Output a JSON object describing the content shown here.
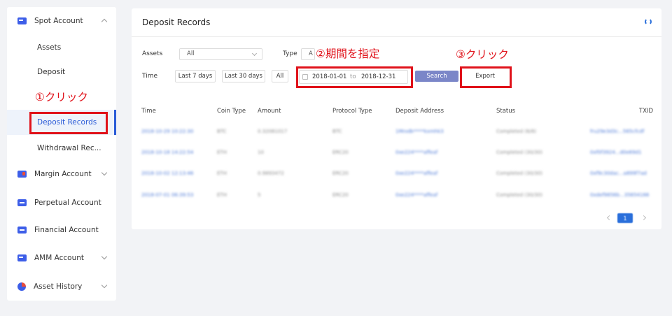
{
  "sidebar": {
    "spot_account": "Spot Account",
    "assets": "Assets",
    "deposit": "Deposit",
    "deposit_records": "Deposit Records",
    "withdrawal_records": "Withdrawal Rec...",
    "margin_account": "Margin Account",
    "perpetual_account": "Perpetual Account",
    "financial_account": "Financial Account",
    "amm_account": "AMM Account",
    "asset_history": "Asset History"
  },
  "panel": {
    "title": "Deposit Records"
  },
  "filters": {
    "assets_label": "Assets",
    "assets_value": "All",
    "type_label": "Type",
    "type_value": "A",
    "time_label": "Time",
    "last7": "Last 7 days",
    "last30": "Last 30 days",
    "all": "All",
    "date_from": "2018-01-01",
    "date_to_label": "to",
    "date_to": "2018-12-31",
    "search": "Search",
    "export": "Export"
  },
  "annotations": {
    "step1": "①クリック",
    "step2": "②期間を指定",
    "step3": "③クリック"
  },
  "table": {
    "headers": [
      "Time",
      "Coin Type",
      "Amount",
      "Protocol Type",
      "Deposit Address",
      "Status",
      "TXID"
    ],
    "rows": [
      [
        "2018-10-29 10:22:30",
        "BTC",
        "0.32081017",
        "BTC",
        "1MnxBr****kxmhk3",
        "Completed (6/6)",
        "fru29e3d3c...565cfcdf"
      ],
      [
        "2018-10-18 14:22:54",
        "ETH",
        "10",
        "ERC20",
        "0xe224****affeaf",
        "Completed (30/30)",
        "0xf0f3924...d0e69d1"
      ],
      [
        "2018-10-02 12:13:46",
        "ETH",
        "0.9893472",
        "ERC20",
        "0xe224****affeaf",
        "Completed (30/30)",
        "0xf9c30dac...a899f7ad"
      ],
      [
        "2018-07-01 06:39:53",
        "ETH",
        "5",
        "ERC20",
        "0xe224****affeaf",
        "Completed (30/30)",
        "0xdef9856b...35654166"
      ]
    ]
  },
  "pagination": {
    "current": "1"
  },
  "colors": {
    "accent": "#2a5bd7",
    "annotation": "#e0121a",
    "search_button": "#7b86c8"
  }
}
